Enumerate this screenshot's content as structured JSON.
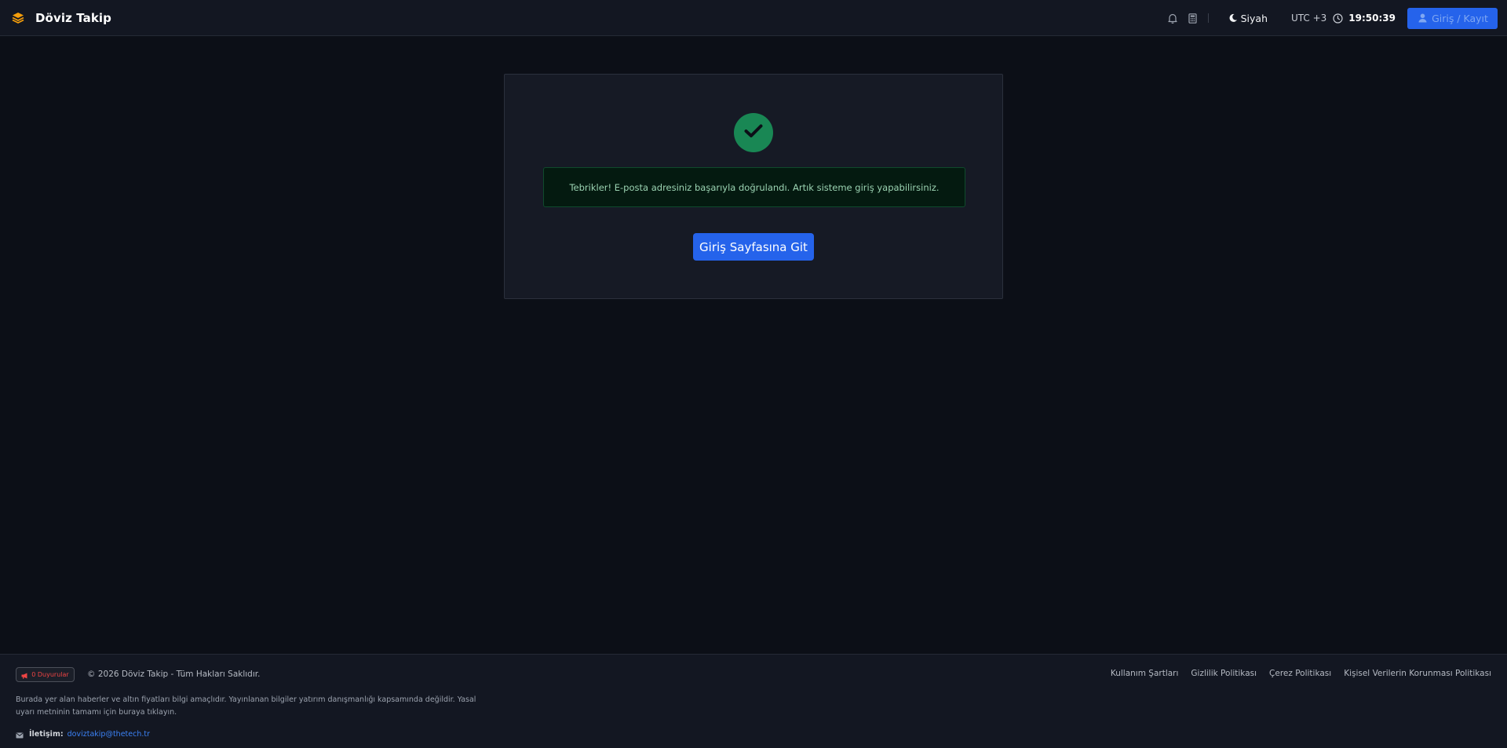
{
  "header": {
    "brand_name": "Döviz Takip",
    "theme_label": "Siyah",
    "timezone_label": "UTC +3",
    "time": "19:50:39",
    "login_label": "Giriş / Kayıt"
  },
  "main": {
    "alert_text": "Tebrikler! E-posta adresiniz başarıyla doğrulandı. Artık sisteme giriş yapabilirsiniz.",
    "button_label": "Giriş Sayfasına Git"
  },
  "footer": {
    "announcements_label": "0 Duyurular",
    "copyright": "© 2026 Döviz Takip - Tüm Hakları Saklıdır.",
    "links": [
      "Kullanım Şartları",
      "Gizlilik Politikası",
      "Çerez Politikası",
      "Kişisel Verilerin Korunması Politikası"
    ],
    "disclaimer": "Burada yer alan haberler ve altın fiyatları bilgi amaçlıdır. Yayınlanan bilgiler yatırım danışmanlığı kapsamında değildir. Yasal uyarı metninin tamamı için buraya tıklayın.",
    "contact_label": "İletişim:",
    "contact_email": "doviztakip@thetech.tr"
  },
  "icons": {
    "brand": "layers-icon",
    "bell": "bell-icon",
    "calculator": "calculator-icon",
    "theme": "moon-icon",
    "clock": "clock-icon",
    "user": "user-icon",
    "success": "check-icon",
    "megaphone": "megaphone-icon",
    "envelope": "envelope-icon"
  },
  "colors": {
    "background": "#0c0f17",
    "header_bg": "#131722",
    "card_bg": "#161a25",
    "accent_blue": "#2563eb",
    "brand_orange": "#f59e0b",
    "success_green": "#198754",
    "alert_bg": "#041a10",
    "alert_text": "#9bd3b2",
    "announcement_red": "#ef4444"
  }
}
